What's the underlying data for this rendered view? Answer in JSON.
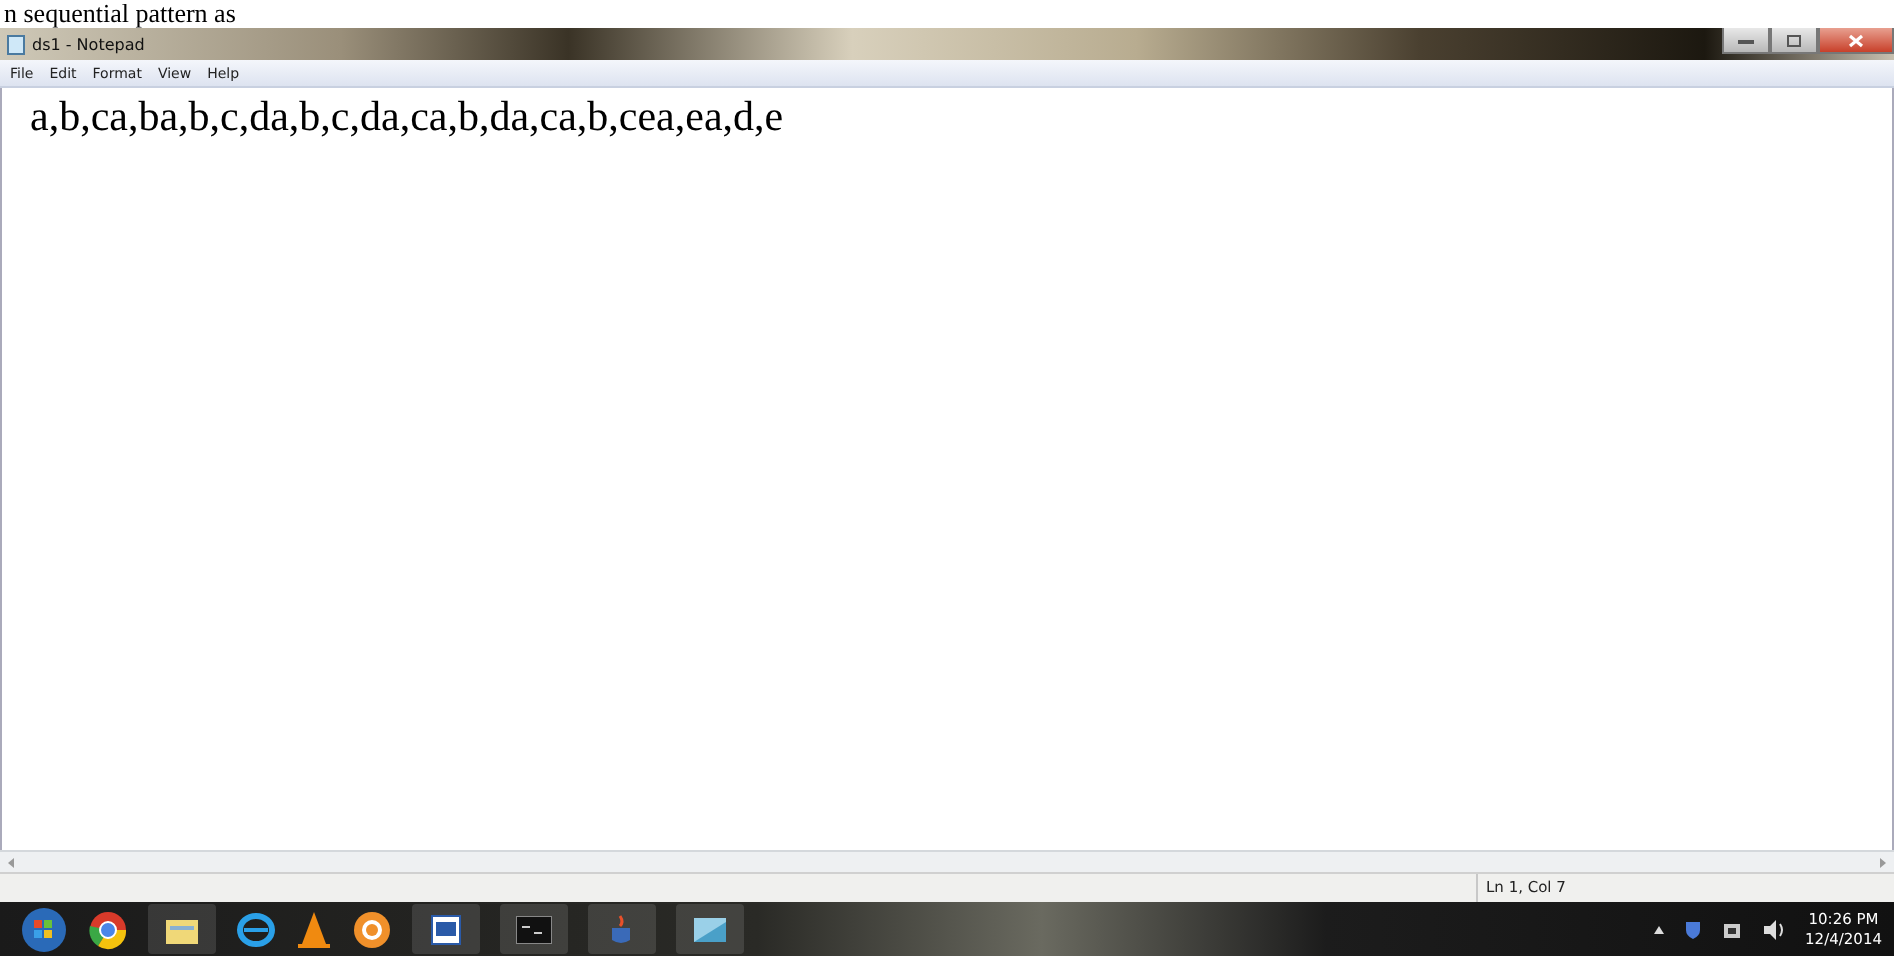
{
  "page_text": "n sequential pattern as",
  "window": {
    "title": "ds1 - Notepad"
  },
  "menu": [
    "File",
    "Edit",
    "Format",
    "View",
    "Help"
  ],
  "document": {
    "text": "a,b,ca,ba,b,c,da,b,c,da,ca,b,da,ca,b,cea,ea,d,e"
  },
  "status_bar": {
    "position": "Ln 1, Col 7"
  },
  "clock": {
    "time": "10:26 PM",
    "date": "12/4/2014"
  }
}
